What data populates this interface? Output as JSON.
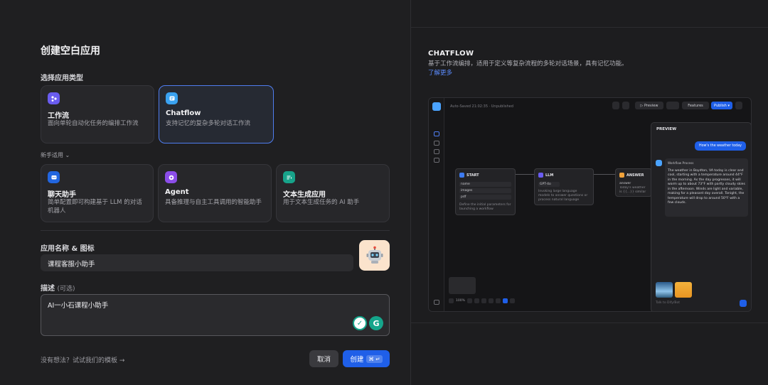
{
  "dialog": {
    "title": "创建空白应用",
    "app_type_label": "选择应用类型",
    "types": [
      {
        "title": "工作流",
        "desc": "面向单轮自动化任务的编排工作流",
        "icon": "workflow-icon",
        "color": "#6a5cf0"
      },
      {
        "title": "Chatflow",
        "desc": "支持记忆的复杂多轮对话工作流",
        "icon": "chatflow-icon",
        "color": "#3aa2f0"
      }
    ],
    "novice_label": "新手适用",
    "novice_types": [
      {
        "title": "聊天助手",
        "desc": "简单配置即可构建基于 LLM 的对话机器人",
        "icon": "chat-assistant-icon",
        "color": "#2266e0"
      },
      {
        "title": "Agent",
        "desc": "具备推理与自主工具调用的智能助手",
        "icon": "agent-icon",
        "color": "#8b4de8"
      },
      {
        "title": "文本生成应用",
        "desc": "用于文本生成任务的 AI 助手",
        "icon": "text-generation-icon",
        "color": "#17a38a"
      }
    ],
    "name_label": "应用名称 & 图标",
    "name_value": "课程客服小助手",
    "avatar_icon": "robot-icon",
    "desc_label": "描述",
    "desc_optional": "(可选)",
    "desc_value": "AI一小石课程小助手",
    "footer_link": "没有想法？试试我们的模板 →",
    "cancel": "取消",
    "create": "创建",
    "create_kbd": "⌘ ↵"
  },
  "info": {
    "title": "CHATFLOW",
    "desc": "基于工作流编排，适用于定义等复杂流程的多轮对话场景，具有记忆功能。",
    "learn_more": "了解更多"
  },
  "preview": {
    "top_text": "Auto-Saved 21:02:35 · Unpublished",
    "btn_preview": "▷ Preview",
    "btn_features": "Features",
    "btn_publish": "Publish ▾",
    "start_title": "START",
    "start_rows": [
      "name",
      "images",
      "pdf"
    ],
    "start_text": "Define the initial parameters for launching a workflow",
    "llm_title": "LLM",
    "llm_model": "GPT-4o",
    "llm_text": "Invoking large language models to answer questions or process natural language",
    "answer_title": "ANSWER",
    "answer_key": "answer",
    "answer_text": "Today's weather is {{...}} similar to extract...",
    "chat_title": "PREVIEW",
    "user_msg": "How's the weather today",
    "workflow_process": "Workflow Process",
    "bot_msg": "The weather in Boydton, VA today is clear and cool, starting with a temperature around 44°F in the morning. As the day progresses, it will warm up to about 73°F with partly cloudy skies in the afternoon. Winds are light and variable, making for a pleasant day overall. Tonight, the temperature will drop to around 50°F with a few clouds.",
    "input_placeholder": "Talk to Dify/Bot",
    "zoom": "100%"
  }
}
